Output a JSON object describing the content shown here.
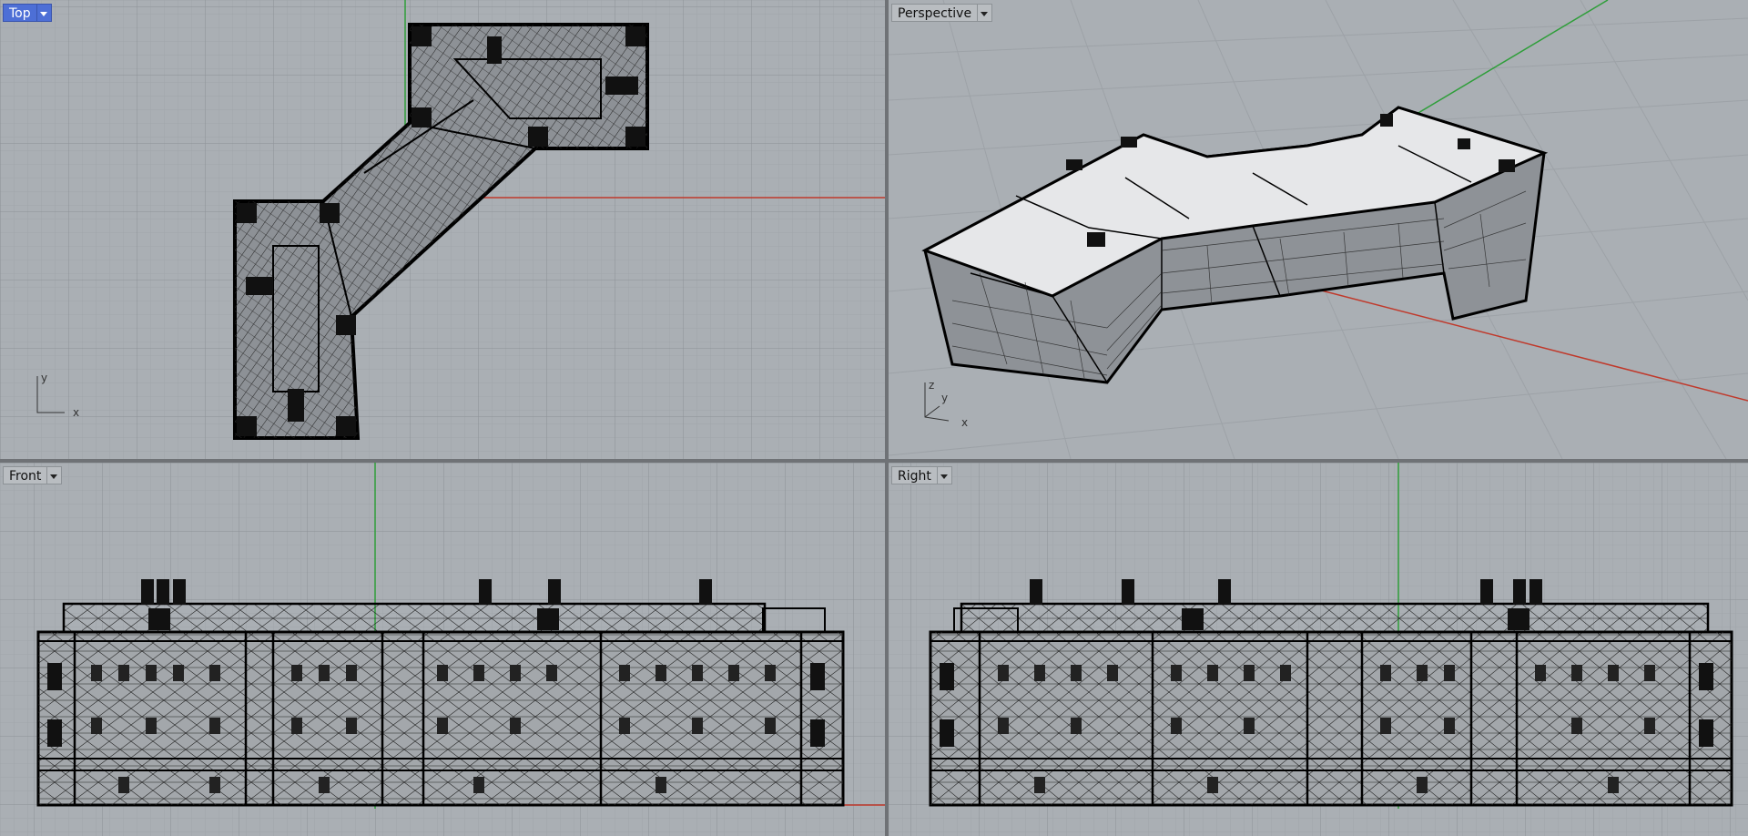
{
  "viewports": {
    "top": {
      "label": "Top",
      "active": true,
      "axes": {
        "a": "y",
        "b": "x"
      }
    },
    "perspective": {
      "label": "Perspective",
      "active": false,
      "axes": {
        "a": "z",
        "b": "y",
        "c": "x"
      }
    },
    "front": {
      "label": "Front",
      "active": false
    },
    "right": {
      "label": "Right",
      "active": false
    }
  },
  "colors": {
    "viewport_bg": "#aaafb4",
    "grid_minor": "#9ea3a8",
    "grid_major": "#8a8f94",
    "x_axis": "#c0392b",
    "y_axis": "#2f9e3a",
    "wire": "#111111",
    "active_tab": "#4d6fd6"
  }
}
